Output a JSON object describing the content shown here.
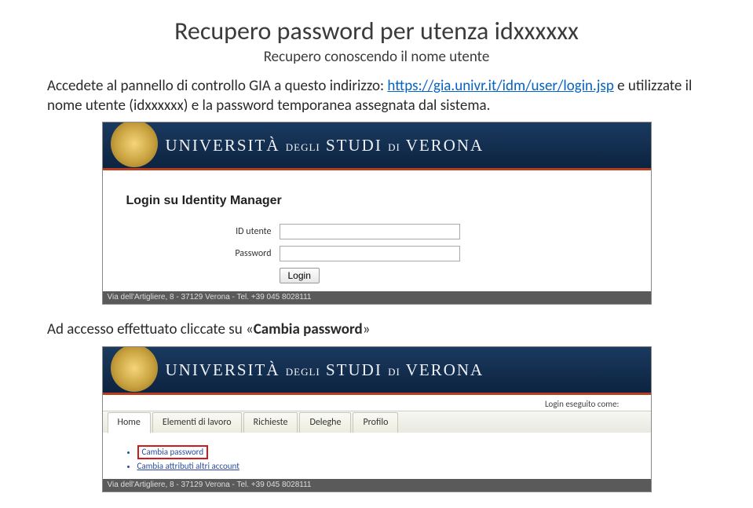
{
  "page": {
    "title": "Recupero password per utenza idxxxxxx",
    "subtitle": "Recupero conoscendo il nome utente",
    "para1_a": "Accedete al pannello di controllo GIA a questo indirizzo: ",
    "link1": "https://gia.univr.it/idm/user/login.jsp",
    "para1_b": " e utilizzate il nome utente (idxxxxxx) e la password temporanea assegnata dal sistema.",
    "para2_a": "Ad accesso effettuato cliccate su «",
    "para2_bold": "Cambia password",
    "para2_b": "»"
  },
  "univ_name_1": "UNIVERSITÀ",
  "univ_name_2": "DEGLI",
  "univ_name_3": "STUDI",
  "univ_name_4": "DI",
  "univ_name_5": "VERONA",
  "screenshot1": {
    "heading": "Login su Identity Manager",
    "id_label": "ID utente",
    "pw_label": "Password",
    "login_btn": "Login",
    "footer": "Via dell'Artigliere, 8 - 37129 Verona - Tel. +39 045 8028111"
  },
  "screenshot2": {
    "login_as": "Login eseguito come:",
    "tabs": {
      "home": "Home",
      "elem": "Elementi di lavoro",
      "rich": "Richieste",
      "deleg": "Deleghe",
      "prof": "Profilo"
    },
    "items": {
      "cambia_pw": "Cambia password",
      "cambia_attr": "Cambia attributi altri account"
    },
    "footer": "Via dell'Artigliere, 8 - 37129 Verona - Tel. +39 045 8028111"
  }
}
